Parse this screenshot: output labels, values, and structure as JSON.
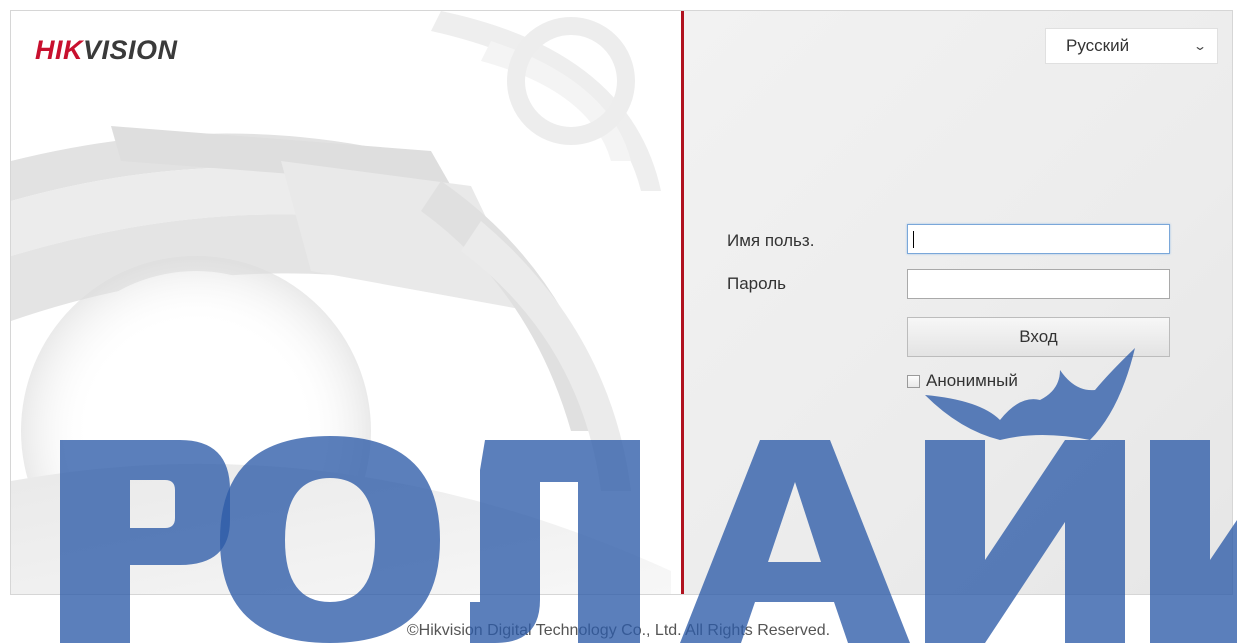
{
  "brand": {
    "logo_part1": "HIK",
    "logo_part2": "VISION"
  },
  "language": {
    "selected": "Русский",
    "icon": "chevron-down-icon"
  },
  "form": {
    "username_label": "Имя польз.",
    "username_value": "",
    "password_label": "Пароль",
    "password_value": "",
    "login_button": "Вход",
    "anonymous_label": "Анонимный",
    "anonymous_checked": false
  },
  "footer": {
    "copyright": "©Hikvision Digital Technology Co., Ltd. All Rights Reserved."
  },
  "colors": {
    "accent": "#b0121f",
    "logo_red": "#c8102e",
    "watermark": "#2d5ba8"
  }
}
